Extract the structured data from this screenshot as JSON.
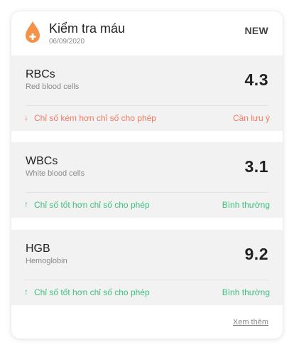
{
  "colors": {
    "accent": "#f4924a",
    "warning": "#f07a63",
    "normal": "#3fbf7f",
    "panel_bg": "#f2f2f2"
  },
  "header": {
    "icon": "blood-drop-icon",
    "title": "Kiểm tra máu",
    "date": "06/09/2020",
    "badge": "NEW"
  },
  "metrics": [
    {
      "name": "RBCs",
      "subtitle": "Red blood cells",
      "value": "4.3",
      "arrow": "↓",
      "status_text": "Chỉ số kém hơn chỉ số cho phép",
      "status_tag": "Cần lưu ý",
      "status": "warning"
    },
    {
      "name": "WBCs",
      "subtitle": "White blood cells",
      "value": "3.1",
      "arrow": "↑",
      "status_text": "Chỉ số tốt hơn chỉ số cho phép",
      "status_tag": "Bình thường",
      "status": "normal"
    },
    {
      "name": "HGB",
      "subtitle": "Hemoglobin",
      "value": "9.2",
      "arrow": "↑",
      "status_text": "Chỉ số tốt hơn chỉ số cho phép",
      "status_tag": "Bình thường",
      "status": "normal"
    }
  ],
  "footer": {
    "see_more": "Xem thêm"
  }
}
